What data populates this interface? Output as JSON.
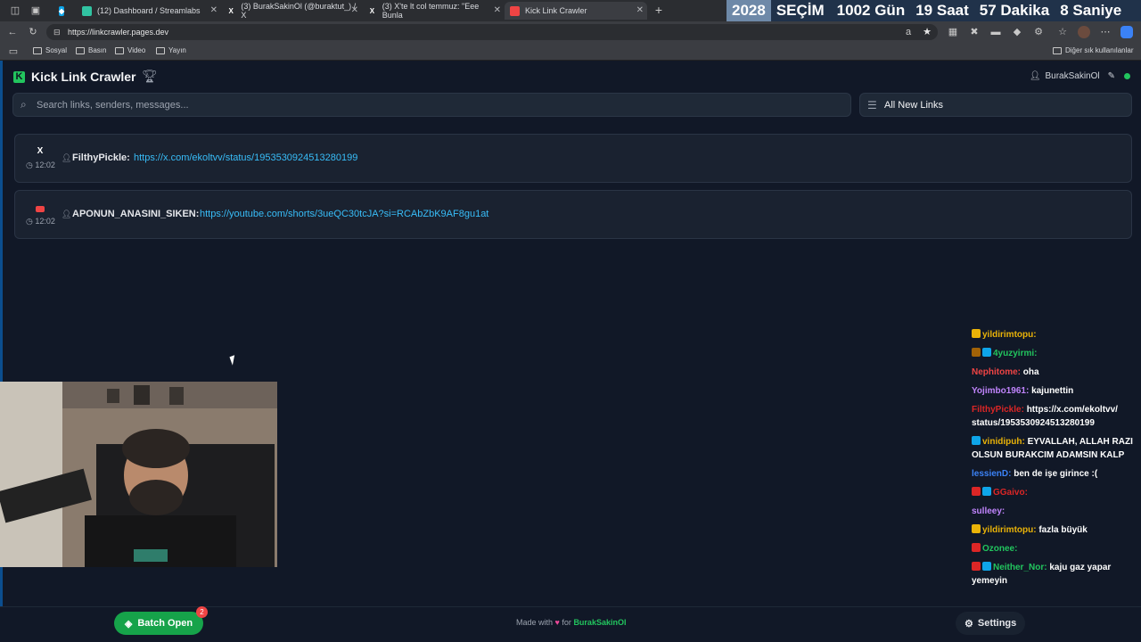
{
  "browser": {
    "tabs": [
      {
        "label": "(12) Dashboard / Streamlabs",
        "favicon": "streamlabs-icon"
      },
      {
        "label": "(3) BurakSakinOl (@buraktut_) / X",
        "favicon": "x-icon"
      },
      {
        "label": "(3) X'te lt col temmuz: \"Eee Bunla",
        "favicon": "x-icon"
      },
      {
        "label": "Kick Link Crawler",
        "favicon": "kick-icon"
      }
    ],
    "url": "https://linkcrawler.pages.dev",
    "bookmarks": [
      "Sosyal",
      "Basın",
      "Video",
      "Yayın"
    ],
    "other_bookmarks": "Diğer sık kullanılanlar"
  },
  "countdown": {
    "year": "2028",
    "title": "SEÇİM",
    "days": "1002 Gün",
    "hours": "19 Saat",
    "minutes": "57 Dakika",
    "seconds": "8 Saniye"
  },
  "app": {
    "title": "Kick Link Crawler",
    "logo_letter": "K",
    "username": "BurakSakinOl",
    "search_placeholder": "Search links, senders, messages...",
    "filter_label": "All New Links",
    "links": [
      {
        "platform": "x",
        "platform_glyph": "X",
        "time": "12:02",
        "sender": "FilthyPickle:",
        "url": "https://x.com/ekoltvv/status/1953530924513280199"
      },
      {
        "platform": "youtube",
        "platform_glyph": "",
        "time": "12:02",
        "sender": "APONUN_ANASINI_SIKEN:",
        "url": "https://youtube.com/shorts/3ueQC30tcJA?si=RCAbZbK9AF8gu1at"
      }
    ]
  },
  "footer": {
    "batch_open_label": "Batch Open",
    "batch_count": "2",
    "made_with": "Made with",
    "for": "for",
    "owner": "BurakSakinOl",
    "settings_label": "Settings"
  },
  "chat": [
    {
      "name": "yildirimtopu:",
      "name_color": "#eab308",
      "message": "",
      "badges": [
        "#eab308"
      ]
    },
    {
      "name": "4yuzyirmi:",
      "name_color": "#22c55e",
      "message": "",
      "badges": [
        "#a16207",
        "#0ea5e9"
      ]
    },
    {
      "name": "Nephitome:",
      "name_color": "#ef4444",
      "message": "oha",
      "badges": []
    },
    {
      "name": "Yojimbo1961:",
      "name_color": "#c084fc",
      "message": "kajunettin",
      "badges": []
    },
    {
      "name": "FilthyPickle:",
      "name_color": "#dc2626",
      "message": "https://x.com/ekoltvv/ status/1953530924513280199",
      "badges": []
    },
    {
      "name": "vinidipuh:",
      "name_color": "#eab308",
      "message": "EYVALLAH, ALLAH RAZI OLSUN BURAKCIM ADAMSIN KALP",
      "badges": [
        "#0ea5e9"
      ]
    },
    {
      "name": "lessienD:",
      "name_color": "#3b82f6",
      "message": "ben de işe girince :(",
      "badges": []
    },
    {
      "name": "GGaivo:",
      "name_color": "#dc2626",
      "message": "",
      "badges": [
        "#dc2626",
        "#0ea5e9"
      ]
    },
    {
      "name": "sulleey:",
      "name_color": "#c084fc",
      "message": "",
      "badges": []
    },
    {
      "name": "yildirimtopu:",
      "name_color": "#eab308",
      "message": "fazla büyük",
      "badges": [
        "#eab308"
      ]
    },
    {
      "name": "Ozonee:",
      "name_color": "#22c55e",
      "message": "",
      "badges": [
        "#dc2626"
      ]
    },
    {
      "name": "Neither_Nor:",
      "name_color": "#22c55e",
      "message": "kaju gaz yapar yemeyin",
      "badges": [
        "#dc2626",
        "#0ea5e9"
      ]
    }
  ]
}
